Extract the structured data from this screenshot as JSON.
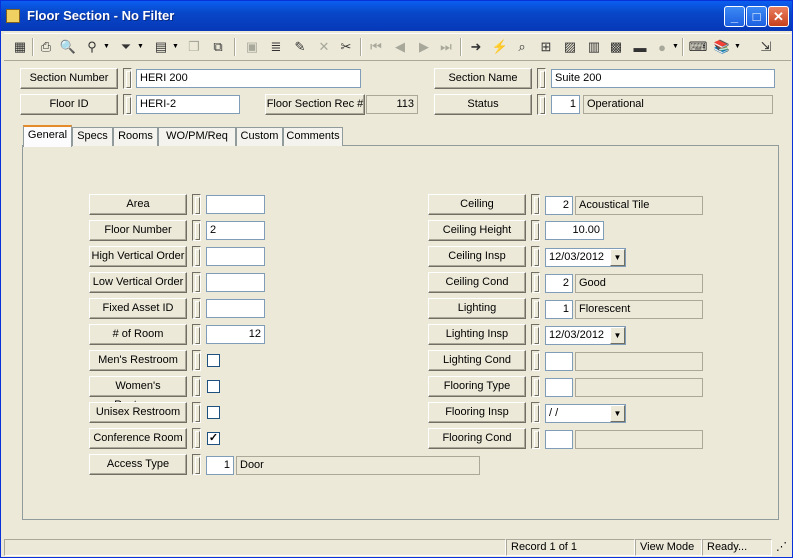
{
  "window": {
    "title": "Floor Section - No Filter"
  },
  "header": {
    "section_number": {
      "label": "Section Number",
      "value": "HERI 200"
    },
    "section_name": {
      "label": "Section Name",
      "value": "Suite 200"
    },
    "floor_id": {
      "label": "Floor ID",
      "value": "HERI-2"
    },
    "floor_section_rec": {
      "label": "Floor Section Rec #",
      "value": "113"
    },
    "status": {
      "label": "Status",
      "code": "1",
      "desc": "Operational"
    }
  },
  "tabs": [
    "General",
    "Specs",
    "Rooms",
    "WO/PM/Req",
    "Custom",
    "Comments"
  ],
  "left_fields": {
    "area": {
      "label": "Area",
      "value": ""
    },
    "floor_number": {
      "label": "Floor Number",
      "value": "2"
    },
    "high_vertical_order": {
      "label": "High Vertical Order",
      "value": ""
    },
    "low_vertical_order": {
      "label": "Low Vertical Order",
      "value": ""
    },
    "fixed_asset_id": {
      "label": "Fixed Asset ID",
      "value": ""
    },
    "num_of_room": {
      "label": "# of Room",
      "value": "12"
    },
    "mens_restroom": {
      "label": "Men's Restroom",
      "checked": false
    },
    "womens_restroom": {
      "label": "Women's Restroom",
      "checked": false
    },
    "unisex_restroom": {
      "label": "Unisex Restroom",
      "checked": false
    },
    "conference_room": {
      "label": "Conference Room",
      "checked": true,
      "mark": "✓"
    },
    "access_type": {
      "label": "Access Type",
      "code": "1",
      "desc": "Door"
    }
  },
  "right_fields": {
    "ceiling": {
      "label": "Ceiling",
      "code": "2",
      "desc": "Acoustical Tile"
    },
    "ceiling_height": {
      "label": "Ceiling Height",
      "value": "10.00"
    },
    "ceiling_insp": {
      "label": "Ceiling Insp",
      "value": "12/03/2012"
    },
    "ceiling_cond": {
      "label": "Ceiling Cond",
      "code": "2",
      "desc": "Good"
    },
    "lighting": {
      "label": "Lighting",
      "code": "1",
      "desc": "Florescent"
    },
    "lighting_insp": {
      "label": "Lighting Insp",
      "value": "12/03/2012"
    },
    "lighting_cond": {
      "label": "Lighting Cond",
      "code": "",
      "desc": ""
    },
    "flooring_type": {
      "label": "Flooring Type",
      "code": "",
      "desc": ""
    },
    "flooring_insp": {
      "label": "Flooring Insp",
      "value": " / /"
    },
    "flooring_cond": {
      "label": "Flooring Cond",
      "code": "",
      "desc": ""
    }
  },
  "statusbar": {
    "record": "Record 1 of 1",
    "mode": "View Mode",
    "state": "Ready..."
  },
  "colors": {
    "titlebar": "#0a5ef0",
    "face": "#ece9d8",
    "tab_accent": "#e68b2c"
  }
}
